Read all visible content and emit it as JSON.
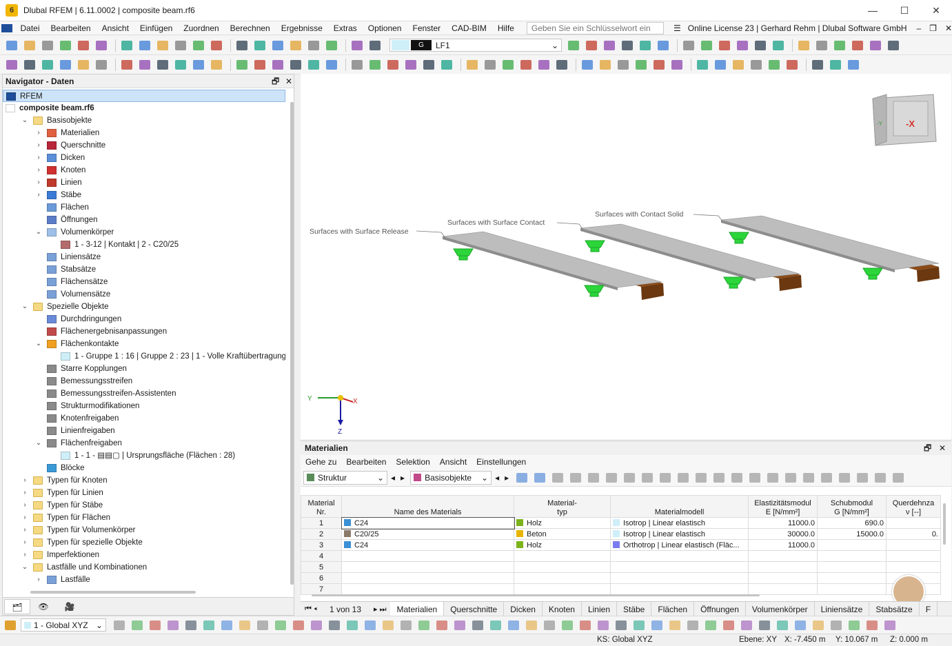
{
  "window": {
    "title": "Dlubal RFEM | 6.11.0002 | composite beam.rf6",
    "app_icon": "rfem-logo-icon"
  },
  "menu": {
    "items": [
      "Datei",
      "Bearbeiten",
      "Ansicht",
      "Einfügen",
      "Zuordnen",
      "Berechnen",
      "Ergebnisse",
      "Extras",
      "Optionen",
      "Fenster",
      "CAD-BIM",
      "Hilfe"
    ],
    "search_placeholder": "Geben Sie ein Schlüsselwort ein (Alt...",
    "license": "Online License 23 | Gerhard Rehm | Dlubal Software GmbH"
  },
  "toolbar": {
    "loadcase_prefix": "G",
    "loadcase": "LF1"
  },
  "navigator": {
    "title": "Navigator - Daten",
    "root": "RFEM",
    "file": "composite beam.rf6",
    "basis": "Basisobjekte",
    "basis_items": [
      "Materialien",
      "Querschnitte",
      "Dicken",
      "Knoten",
      "Linien",
      "Stäbe",
      "Flächen",
      "Öffnungen",
      "Volumenkörper"
    ],
    "solid_child": "1 - 3-12 | Kontakt | 2 - C20/25",
    "set_items": [
      "Liniensätze",
      "Stabsätze",
      "Flächensätze",
      "Volumensätze"
    ],
    "special": "Spezielle Objekte",
    "special_items": [
      "Durchdringungen",
      "Flächenergebnisanpassungen",
      "Flächenkontakte"
    ],
    "contact_child": "1 - Gruppe 1 : 16 | Gruppe 2 : 23 | 1 - Volle Kraftübertragung",
    "special_items2": [
      "Starre Kopplungen",
      "Bemessungsstreifen",
      "Bemessungsstreifen-Assistenten",
      "Strukturmodifikationen",
      "Knotenfreigaben",
      "Linienfreigaben",
      "Flächenfreigaben"
    ],
    "release_child": "1 - 1 - ▤▤▢ | Ursprungsfläche (Flächen : 28)",
    "blocks": "Blöcke",
    "folders": [
      "Typen für Knoten",
      "Typen für Linien",
      "Typen für Stäbe",
      "Typen für Flächen",
      "Typen für Volumenkörper",
      "Typen für spezielle Objekte",
      "Imperfektionen",
      "Lastfälle und Kombinationen"
    ],
    "last": "Lastfälle"
  },
  "viewport": {
    "labels": [
      "Surfaces with Surface Release",
      "Surfaces with Surface Contact",
      "Surfaces with Contact Solid"
    ],
    "cube_face": "-X",
    "cube_side": "-Y",
    "axes": {
      "x": "X",
      "y": "Y",
      "z": "Z"
    }
  },
  "materials": {
    "title": "Materialien",
    "menu": [
      "Gehe zu",
      "Bearbeiten",
      "Selektion",
      "Ansicht",
      "Einstellungen"
    ],
    "combo1": "Struktur",
    "combo2": "Basisobjekte",
    "headers": {
      "nr": "Material\nNr.",
      "name": "Name des Materials",
      "type": "Material-\ntyp",
      "model": "Materialmodell",
      "e": "Elastizitätsmodul\nE [N/mm²]",
      "g": "Schubmodul\nG [N/mm²]",
      "nu": "Querdehnza\nν [--]"
    },
    "rows": [
      {
        "nr": "1",
        "name": "C24",
        "name_color": "#3a8fd6",
        "type": "Holz",
        "type_color": "#7bb31a",
        "model": "Isotrop | Linear elastisch",
        "model_color": "#cfeff8",
        "e": "11000.0",
        "g": "690.0",
        "nu": ""
      },
      {
        "nr": "2",
        "name": "C20/25",
        "name_color": "#8a7a6a",
        "type": "Beton",
        "type_color": "#e8b400",
        "model": "Isotrop | Linear elastisch",
        "model_color": "#cfeff8",
        "e": "30000.0",
        "g": "15000.0",
        "nu": "0."
      },
      {
        "nr": "3",
        "name": "C24",
        "name_color": "#3a8fd6",
        "type": "Holz",
        "type_color": "#7bb31a",
        "model": "Orthotrop | Linear elastisch (Fläc...",
        "model_color": "#7b7bf0",
        "e": "11000.0",
        "g": "",
        "nu": ""
      },
      {
        "nr": "4",
        "name": "",
        "type": "",
        "model": "",
        "e": "",
        "g": "",
        "nu": ""
      },
      {
        "nr": "5",
        "name": "",
        "type": "",
        "model": "",
        "e": "",
        "g": "",
        "nu": ""
      },
      {
        "nr": "6",
        "name": "",
        "type": "",
        "model": "",
        "e": "",
        "g": "",
        "nu": ""
      },
      {
        "nr": "7",
        "name": "",
        "type": "",
        "model": "",
        "e": "",
        "g": "",
        "nu": ""
      }
    ],
    "pager": "1 von 13",
    "tabs": [
      "Materialien",
      "Querschnitte",
      "Dicken",
      "Knoten",
      "Linien",
      "Stäbe",
      "Flächen",
      "Öffnungen",
      "Volumenkörper",
      "Liniensätze",
      "Stabsätze",
      "F"
    ]
  },
  "bottom": {
    "coord_system": "1 - Global XYZ"
  },
  "status": {
    "ks": "KS: Global XYZ",
    "plane": "Ebene: XY",
    "x": "X: -7.450 m",
    "y": "Y: 10.067 m",
    "z": "Z: 0.000 m"
  }
}
